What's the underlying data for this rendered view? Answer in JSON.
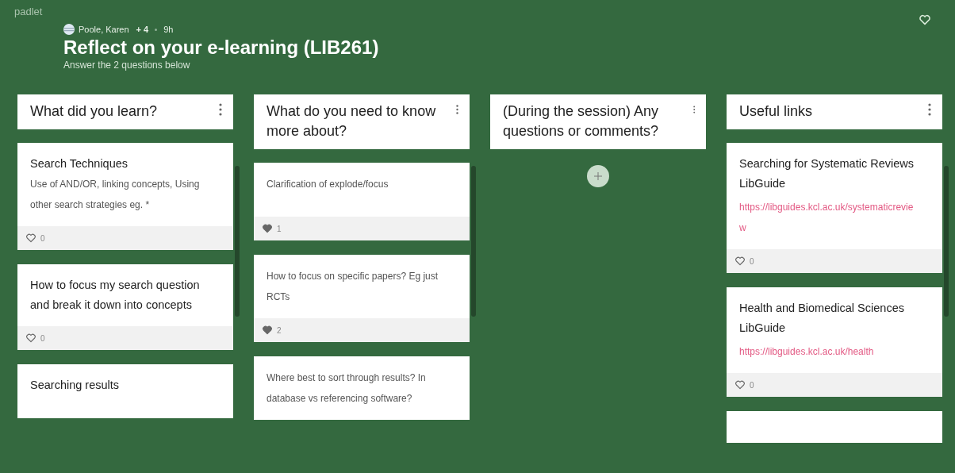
{
  "app": {
    "logo": "padlet"
  },
  "header": {
    "author": "Poole, Karen",
    "contributors": "+ 4",
    "age": "9h",
    "title": "Reflect on your e-learning (LIB261)",
    "subtitle": "Answer the 2 questions below"
  },
  "columns": [
    {
      "title": "What did you learn?",
      "posts": [
        {
          "title": "Search Techniques",
          "body": "Use of AND/OR, linking concepts, Using other search strategies eg. *",
          "likes": "0",
          "liked": false
        },
        {
          "title": "How to focus my search question and break it down into concepts",
          "likes": "0",
          "liked": false
        },
        {
          "title": "Searching results"
        }
      ]
    },
    {
      "title": "What do you need to know more about?",
      "posts": [
        {
          "body": "Clarification of explode/focus",
          "likes": "1",
          "liked": true
        },
        {
          "body": "How to focus on specific papers? Eg just RCTs",
          "likes": "2",
          "liked": true
        },
        {
          "body": "Where best to sort through results? In database vs referencing software?"
        }
      ]
    },
    {
      "title": "(During the session) Any questions or comments?",
      "add_button": true
    },
    {
      "title": "Useful links",
      "posts": [
        {
          "title": "Searching for Systematic Reviews LibGuide",
          "link": "https://libguides.kcl.ac.uk/systematicreview",
          "likes": "0",
          "liked": false
        },
        {
          "title": "Health and Biomedical Sciences LibGuide",
          "link": "https://libguides.kcl.ac.uk/health",
          "likes": "0",
          "liked": false
        },
        {
          "kind": "stub"
        }
      ]
    }
  ]
}
